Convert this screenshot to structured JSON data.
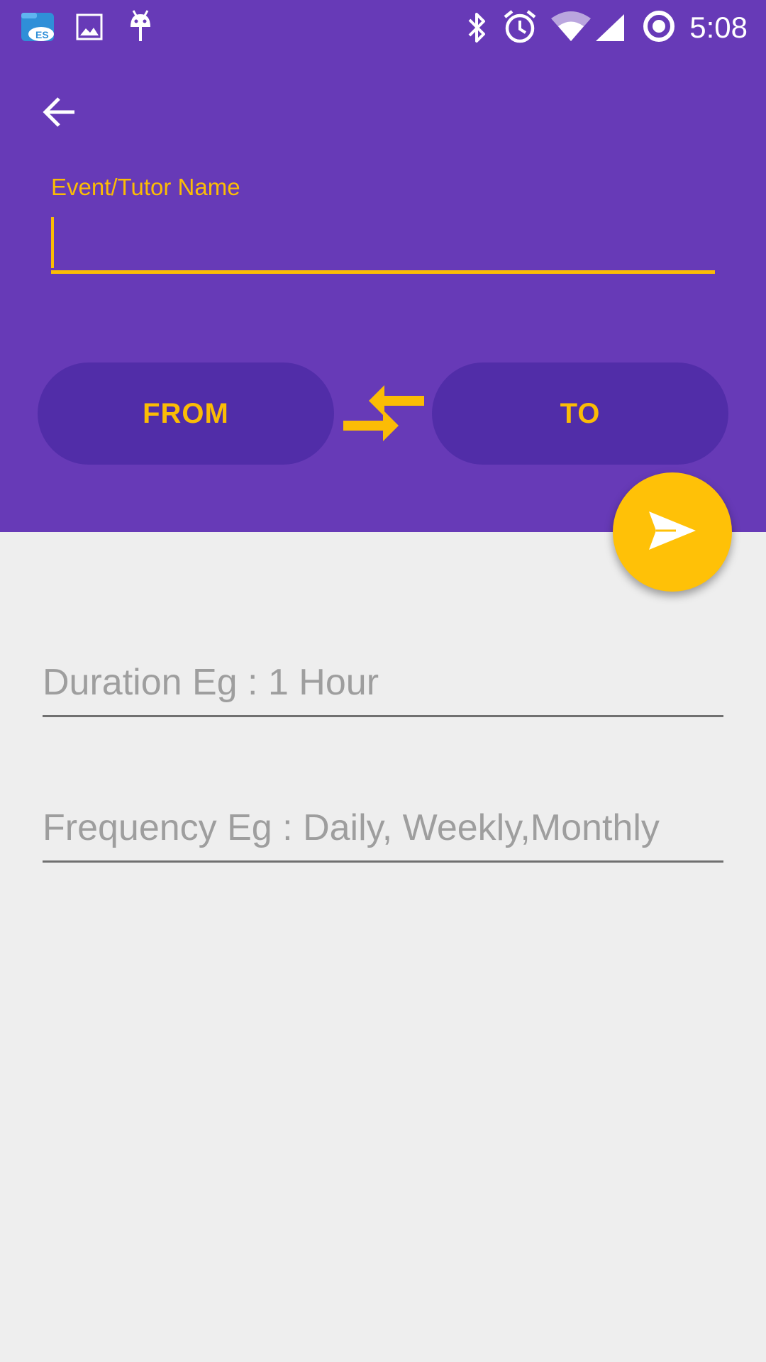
{
  "status_bar": {
    "time": "5:08",
    "left_icons": [
      "es-file-explorer-icon",
      "gallery-icon",
      "android-debug-icon"
    ],
    "right_icons": [
      "bluetooth-icon",
      "alarm-icon",
      "wifi-icon",
      "signal-icon",
      "sync-circle-icon"
    ]
  },
  "header": {
    "back_icon": "arrow-back-icon",
    "event_name": {
      "label": "Event/Tutor Name",
      "value": ""
    },
    "from_label": "FROM",
    "to_label": "TO",
    "swap_icon": "compare-arrows-icon"
  },
  "fab": {
    "icon": "send-icon"
  },
  "form": {
    "duration": {
      "placeholder": "Duration Eg : 1 Hour",
      "value": ""
    },
    "frequency": {
      "placeholder": "Frequency Eg : Daily, Weekly,Monthly",
      "value": ""
    }
  },
  "colors": {
    "primary": "#673ab7",
    "primary_dark": "#512da8",
    "accent": "#fbbc05",
    "fab": "#ffc107",
    "background": "#eeeeee"
  }
}
